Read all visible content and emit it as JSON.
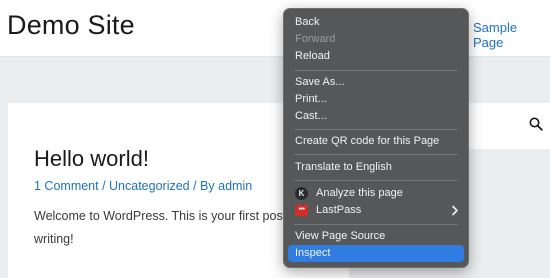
{
  "site": {
    "title": "Demo Site",
    "nav_link": "Sample Page"
  },
  "post": {
    "title": "Hello world!",
    "meta": {
      "comments": "1 Comment",
      "sep1": " / ",
      "category": "Uncategorized",
      "sep2": " / By ",
      "author": "admin"
    },
    "excerpt_line1": "Welcome to WordPress. This is your first post.",
    "excerpt_line2": "writing!"
  },
  "sidebar": {
    "search_icon": "search-icon"
  },
  "context_menu": {
    "items": [
      {
        "label": "Back",
        "enabled": true
      },
      {
        "label": "Forward",
        "enabled": false
      },
      {
        "label": "Reload",
        "enabled": true
      },
      {
        "label": "Save As...",
        "enabled": true
      },
      {
        "label": "Print...",
        "enabled": true
      },
      {
        "label": "Cast...",
        "enabled": true
      },
      {
        "label": "Create QR code for this Page",
        "enabled": true
      },
      {
        "label": "Translate to English",
        "enabled": true
      },
      {
        "label": "Analyze this page",
        "enabled": true,
        "icon": "k-extension-icon",
        "icon_text": "K"
      },
      {
        "label": "LastPass",
        "enabled": true,
        "icon": "lastpass-icon",
        "icon_text": "•••",
        "submenu": true
      },
      {
        "label": "View Page Source",
        "enabled": true
      },
      {
        "label": "Inspect",
        "enabled": true,
        "highlighted": true
      }
    ]
  },
  "colors": {
    "link": "#1e73be",
    "menu_bg": "#565758",
    "menu_highlight": "#2f7ce2"
  }
}
